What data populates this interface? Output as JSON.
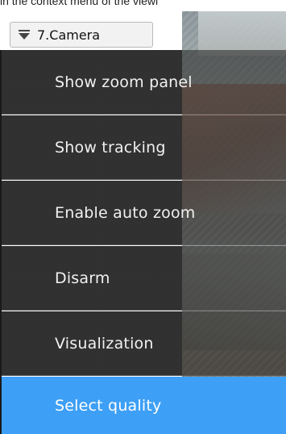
{
  "top_caption": "in the context menu of the viewi",
  "camera": {
    "label": "7.Camera",
    "icon": "chevron-down-icon"
  },
  "menu": {
    "items": [
      {
        "label": "Show zoom panel"
      },
      {
        "label": "Show tracking"
      },
      {
        "label": "Enable auto zoom"
      },
      {
        "label": "Disarm"
      },
      {
        "label": "Visualization"
      },
      {
        "label": "Select quality",
        "selected": true
      }
    ]
  },
  "colors": {
    "menu_bg": "#2a2a2a",
    "selected_bg": "#3d9ff5",
    "menu_text": "#f1f1f1"
  }
}
